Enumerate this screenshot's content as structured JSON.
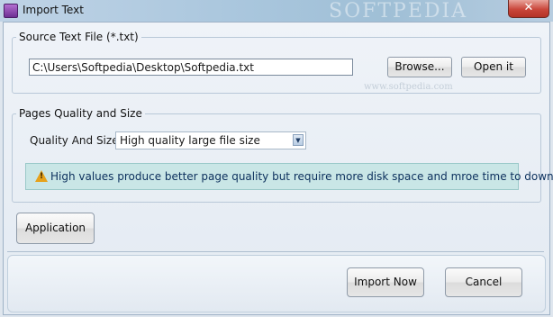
{
  "window": {
    "title": "Import Text",
    "close_glyph": "✕"
  },
  "source_group": {
    "legend": "Source Text File (*.txt)",
    "path_value": "C:\\Users\\Softpedia\\Desktop\\Softpedia.txt",
    "browse_label": "Browse...",
    "open_label": "Open it"
  },
  "quality_group": {
    "legend": "Pages Quality and Size",
    "field_label": "Quality And Size:",
    "selected_option": "High quality large file size",
    "notice": "High values produce better page quality but require more disk space and mroe time to download."
  },
  "application_label": "Application",
  "footer": {
    "import_label": "Import Now",
    "cancel_label": "Cancel"
  },
  "watermarks": {
    "top": "SOFTPEDIA",
    "url": "www.softpedia.com"
  }
}
